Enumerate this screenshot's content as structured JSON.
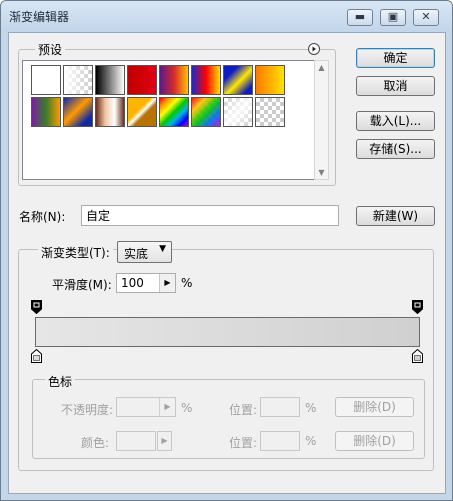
{
  "window": {
    "title": "渐变编辑器",
    "minimize_icon": "minimize-icon",
    "maximize_icon": "maximize-icon",
    "close_icon": "close-icon"
  },
  "presets": {
    "label": "预设",
    "menu_icon": "circle-arrow-right-icon",
    "swatch_count": 16
  },
  "buttons": {
    "ok": "确定",
    "cancel": "取消",
    "load": "载入(L)...",
    "save": "存储(S)...",
    "new": "新建(W)"
  },
  "name": {
    "label": "名称(N):",
    "value": "自定"
  },
  "gradient_type": {
    "label": "渐变类型(T):",
    "value": "实底"
  },
  "smoothness": {
    "label": "平滑度(M):",
    "value": "100",
    "unit": "%"
  },
  "color_stops": {
    "group_label": "色标",
    "opacity_label": "不透明度:",
    "opacity_unit": "%",
    "location_label": "位置:",
    "location_unit": "%",
    "delete_label": "删除(D)",
    "color_label": "颜色:"
  },
  "colors": {
    "title_bar": "#c4d6e9",
    "panel_bg": "#f0f0f0",
    "default_button_border": "#3c7fb1"
  }
}
